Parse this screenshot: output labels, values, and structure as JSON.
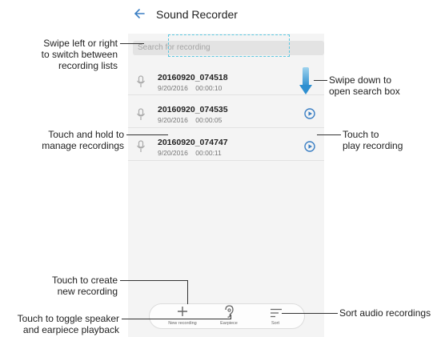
{
  "app": {
    "title": "Sound Recorder",
    "search_placeholder": "Search for recording"
  },
  "recordings": [
    {
      "name": "20160920_074518",
      "date": "9/20/2016",
      "duration": "00:00:10"
    },
    {
      "name": "20160920_074535",
      "date": "9/20/2016",
      "duration": "00:00:05"
    },
    {
      "name": "20160920_074747",
      "date": "9/20/2016",
      "duration": "00:00:11"
    }
  ],
  "bottom_bar": {
    "new_recording_label": "New recording",
    "earpiece_label": "Earpiece",
    "sort_label": "Sort"
  },
  "callouts": {
    "swipe_switch_l1": "Swipe left or right",
    "swipe_switch_l2": "to switch between",
    "swipe_switch_l3": "recording lists",
    "swipe_down_l1": "Swipe down to",
    "swipe_down_l2": "open search box",
    "touch_hold_l1": "Touch and hold to",
    "touch_hold_l2": "manage recordings",
    "touch_play_l1": "Touch to",
    "touch_play_l2": "play recording",
    "touch_create_l1": "Touch to create",
    "touch_create_l2": "new recording",
    "toggle_l1": "Touch to toggle speaker",
    "toggle_l2": "and earpiece playback",
    "sort_audio": "Sort audio recordings"
  },
  "colors": {
    "accent": "#3b7fc4",
    "swipe_arrow": "#3fa0d8",
    "dash": "#5bc7e0"
  },
  "icons": [
    "back-arrow-icon",
    "microphone-icon",
    "play-icon",
    "plus-icon",
    "earpiece-icon",
    "sort-icon",
    "swipe-down-arrow-icon"
  ]
}
